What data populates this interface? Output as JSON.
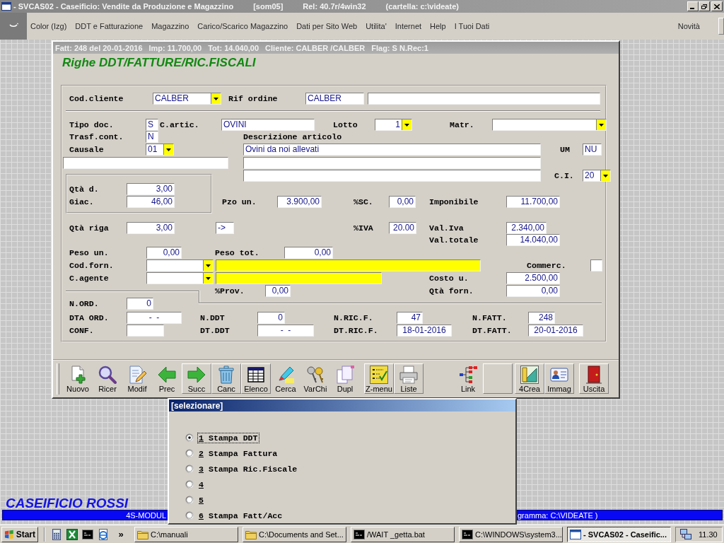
{
  "window": {
    "title_parts": [
      "- SVCAS02 - Caseificio: Vendite da Produzione e Magazzino",
      "[som05]",
      "Rel: 40.7r/4win32",
      "(cartella: c:\\videate)"
    ]
  },
  "menu": {
    "items": [
      "Color (Izg)",
      "DDT e Fatturazione",
      "Magazzino",
      "Carico/Scarico Magazzino",
      "Dati per Sito Web",
      "Utilita'",
      "Internet",
      "Help",
      "I Tuoi Dati"
    ],
    "right": "Novità"
  },
  "form": {
    "summary": [
      "Fatt: 248 del 20-01-2016",
      "Imp: 11.700,00",
      "Tot: 14.040,00",
      "Cliente: CALBER /CALBER",
      "Flag: S N.Rec:1"
    ],
    "title": "Righe DDT/FATTURE/RIC.FISCALI",
    "fields": [
      {
        "label": "Cod.cliente",
        "kind": "combo",
        "value": "CALBER"
      },
      {
        "label": "Rif ordine",
        "kind": "text",
        "value": "CALBER"
      },
      {
        "kind": "text"
      },
      {
        "label": "Tipo doc.",
        "kind": "text",
        "value": "S"
      },
      {
        "label": "C.artic.",
        "kind": "text",
        "value": "OVINI"
      },
      {
        "label": "Lotto",
        "kind": "combo",
        "value": "1"
      },
      {
        "label": "Matr.",
        "kind": "combo"
      },
      {
        "label": "Trasf.cont.",
        "kind": "text",
        "value": "N"
      },
      {
        "label": "Descrizione articolo"
      },
      {
        "label": "Causale",
        "kind": "combo",
        "value": "01"
      },
      {
        "kind": "text",
        "value": "Ovini da noi allevati"
      },
      {
        "label": "UM",
        "kind": "text",
        "value": "NU"
      },
      {
        "kind": "text"
      },
      {
        "kind": "text"
      },
      {
        "kind": "text"
      },
      {
        "label": "C.I.",
        "kind": "combo",
        "value": "20"
      },
      {
        "label": "Qtà d.",
        "kind": "text",
        "value": "3,00"
      },
      {
        "label": "Giac.",
        "kind": "text",
        "value": "46,00"
      },
      {
        "label": "Pzo un.",
        "kind": "text",
        "value": "3.900,00"
      },
      {
        "label": "%SC.",
        "kind": "text",
        "value": "0,00"
      },
      {
        "label": "Imponibile",
        "kind": "text",
        "value": "11.700,00"
      },
      {
        "label": "Qtà riga",
        "kind": "text",
        "value": "3,00"
      },
      {
        "kind": "text",
        "value": "->"
      },
      {
        "label": "%IVA",
        "kind": "text",
        "value": "20.00"
      },
      {
        "label": "Val.Iva",
        "kind": "text",
        "value": "2.340,00"
      },
      {
        "label": "Val.totale",
        "kind": "text",
        "value": "14.040,00"
      },
      {
        "label": "Peso un.",
        "kind": "text",
        "value": "0,00"
      },
      {
        "label": "Peso tot.",
        "kind": "text",
        "value": "0,00"
      },
      {
        "label": "Cod.forn.",
        "kind": "combo"
      },
      {
        "kind": "lookup"
      },
      {
        "label": "Commerc.",
        "kind": "check",
        "checked": false
      },
      {
        "label": "C.agente",
        "kind": "combo"
      },
      {
        "kind": "lookup"
      },
      {
        "label": "Costo u.",
        "kind": "text",
        "value": "2.500,00"
      },
      {
        "label": "%Prov.",
        "kind": "text",
        "value": "0,00"
      },
      {
        "label": "Qtà forn.",
        "kind": "text",
        "value": "0,00"
      },
      {
        "label": "N.ORD.",
        "kind": "text",
        "value": "0"
      },
      {
        "label": "DTA ORD.",
        "kind": "text",
        "value": "-  -"
      },
      {
        "label": "N.DDT",
        "kind": "text",
        "value": "0"
      },
      {
        "label": "N.RIC.F.",
        "kind": "text",
        "value": "47"
      },
      {
        "label": "N.FATT.",
        "kind": "text",
        "value": "248"
      },
      {
        "label": "CONF.",
        "kind": "text"
      },
      {
        "label": "DT.DDT",
        "kind": "text",
        "value": "-  -"
      },
      {
        "label": "DT.RIC.F.",
        "kind": "text",
        "value": "18-01-2016"
      },
      {
        "label": "DT.FATT.",
        "kind": "text",
        "value": "20-01-2016"
      }
    ],
    "tools": [
      {
        "label": "Nuovo",
        "raised": false
      },
      {
        "label": "Ricer",
        "raised": false
      },
      {
        "label": "Modif",
        "raised": false
      },
      {
        "label": "Prec",
        "raised": false
      },
      {
        "label": "Succ",
        "raised": true
      },
      {
        "label": "Canc",
        "raised": true
      },
      {
        "label": "Elenco",
        "raised": true
      },
      {
        "label": "Cerca",
        "raised": false
      },
      {
        "label": "VarChi",
        "raised": false
      },
      {
        "label": "Dupl",
        "raised": false
      },
      {
        "label": "Z-menu",
        "raised": true
      },
      {
        "label": "Liste",
        "raised": true
      },
      {
        "label": "Link",
        "raised": false
      },
      {
        "raised": true
      },
      {
        "label": "4Crea",
        "raised": true
      },
      {
        "label": "Immag",
        "raised": true
      },
      {
        "label": "Uscita",
        "raised": true
      }
    ]
  },
  "dialog": {
    "title": "[selezionare]",
    "options": [
      {
        "key": "1",
        "label": "Stampa DDT",
        "selected": true
      },
      {
        "key": "2",
        "label": "Stampa Fattura",
        "selected": false
      },
      {
        "key": "3",
        "label": "Stampa Ric.Fiscale",
        "selected": false
      },
      {
        "key": "4",
        "selected": false
      },
      {
        "key": "5",
        "selected": false
      },
      {
        "key": "6",
        "label": "Stampa Fatt/Acc",
        "selected": false
      }
    ]
  },
  "footer": {
    "company": "CASEIFICIO ROSSI",
    "status_left": "4S-MODUL",
    "status_right": "gramma: C:\\VIDEATE )"
  },
  "taskbar": {
    "start": "Start",
    "more": "»",
    "tasks": [
      {
        "kind": "folder",
        "label": "C:\\manuali",
        "selected": false
      },
      {
        "kind": "folder",
        "label": "C:\\Documents and Set...",
        "selected": false
      },
      {
        "kind": "console",
        "label": "/WAIT _getta.bat",
        "selected": false
      },
      {
        "kind": "console",
        "label": "C:\\WINDOWS\\system3...",
        "selected": false
      },
      {
        "kind": "window",
        "label": "- SVCAS02 - Caseific...",
        "selected": true
      }
    ],
    "clock": "11.30"
  }
}
